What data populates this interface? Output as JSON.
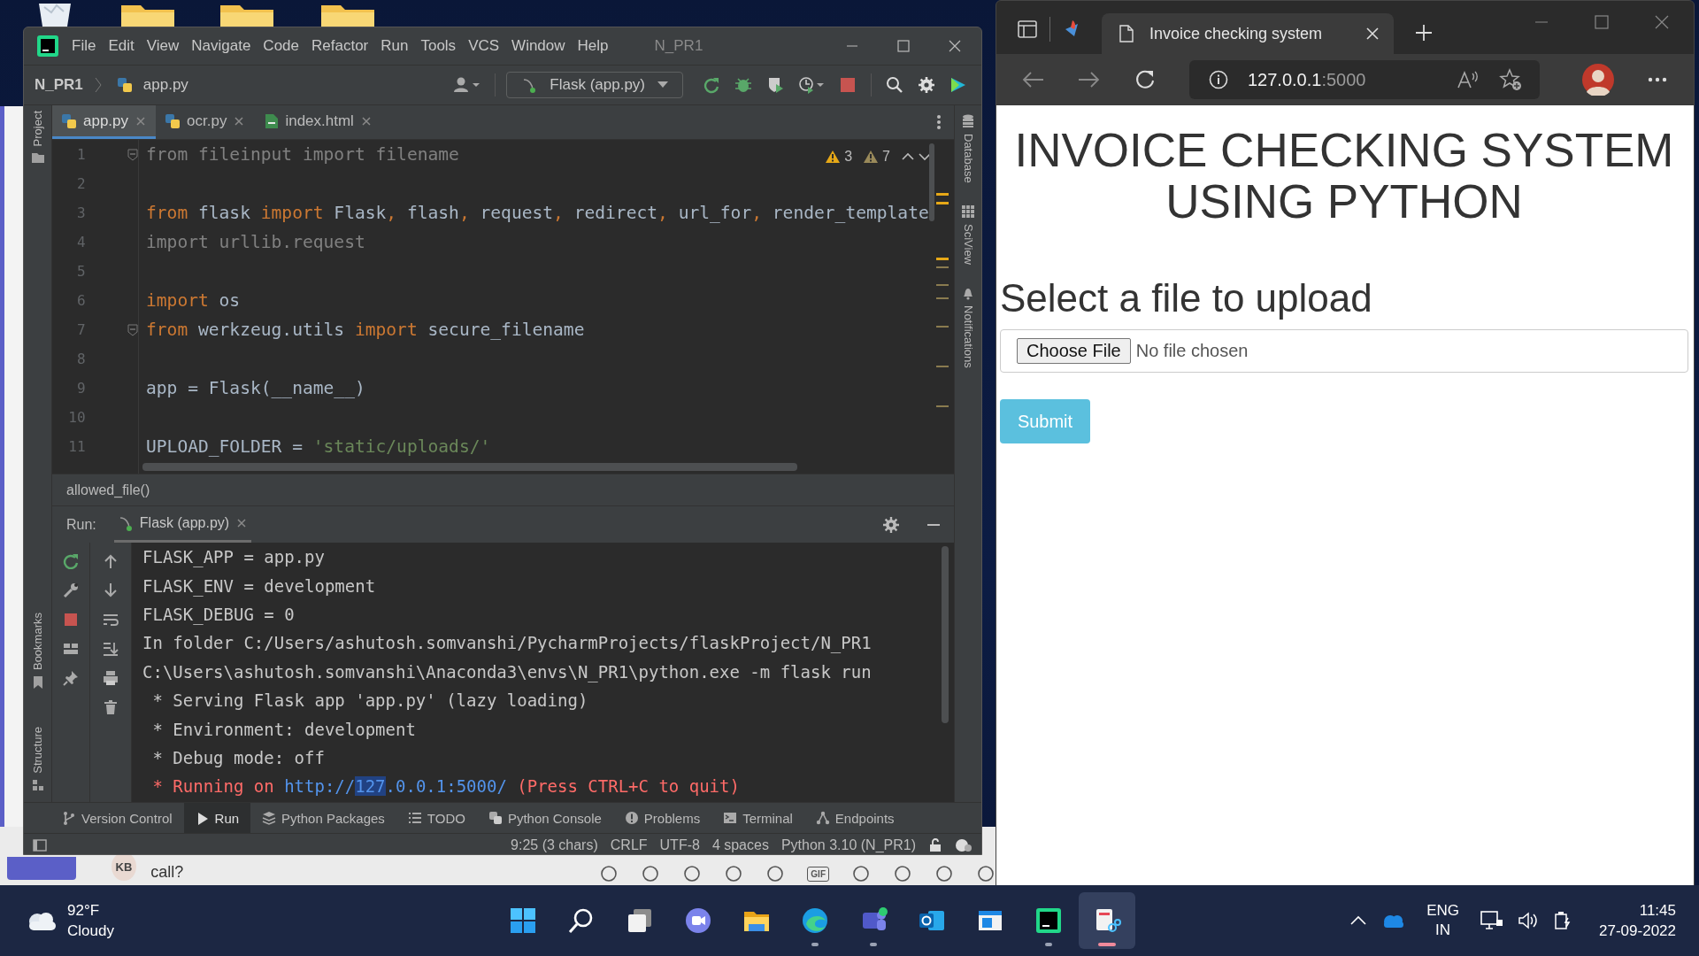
{
  "desktop": {
    "icons": [
      {
        "kind": "recycle-bin"
      },
      {
        "kind": "folder"
      },
      {
        "kind": "folder"
      },
      {
        "kind": "folder"
      }
    ]
  },
  "background_chat": {
    "avatar": "KB",
    "message": "call?",
    "gif_label": "GIF"
  },
  "ide": {
    "menu": [
      "File",
      "Edit",
      "View",
      "Navigate",
      "Code",
      "Refactor",
      "Run",
      "Tools",
      "VCS",
      "Window",
      "Help"
    ],
    "title": "N_PR1",
    "breadcrumb": [
      "N_PR1",
      "app.py"
    ],
    "run_config": "Flask (app.py)",
    "left_tools": [
      "Project",
      "Bookmarks",
      "Structure"
    ],
    "right_tools": [
      "Database",
      "SciView",
      "Notifications"
    ],
    "tabs": [
      {
        "label": "app.py",
        "kind": "python",
        "selected": true
      },
      {
        "label": "ocr.py",
        "kind": "python",
        "selected": false
      },
      {
        "label": "index.html",
        "kind": "html",
        "selected": false
      }
    ],
    "inspections": [
      {
        "kind": "warning",
        "count": "3"
      },
      {
        "kind": "weak-warning",
        "count": "7"
      }
    ],
    "code_lines": [
      {
        "number": "1",
        "fold": true,
        "tokens": [
          {
            "kind": "unused",
            "text": "from fileinput import filename"
          }
        ]
      },
      {
        "number": "2",
        "fold": false
      },
      {
        "number": "3",
        "fold": false,
        "tokens": [
          {
            "kind": "kw",
            "text": "from"
          },
          {
            "kind": "id",
            "text": " flask "
          },
          {
            "kind": "kw",
            "text": "import"
          },
          {
            "kind": "id",
            "text": " Flask"
          },
          {
            "kind": "kw",
            "text": ","
          },
          {
            "kind": "id",
            "text": " flash"
          },
          {
            "kind": "kw",
            "text": ","
          },
          {
            "kind": "id",
            "text": " request"
          },
          {
            "kind": "kw",
            "text": ","
          },
          {
            "kind": "id",
            "text": " redirect"
          },
          {
            "kind": "kw",
            "text": ","
          },
          {
            "kind": "id",
            "text": " url_for"
          },
          {
            "kind": "kw",
            "text": ","
          },
          {
            "kind": "id",
            "text": " render_template"
          }
        ]
      },
      {
        "number": "4",
        "fold": false,
        "tokens": [
          {
            "kind": "unused",
            "text": "import urllib.request"
          }
        ]
      },
      {
        "number": "5",
        "fold": false
      },
      {
        "number": "6",
        "fold": false,
        "tokens": [
          {
            "kind": "kw",
            "text": "import"
          },
          {
            "kind": "id",
            "text": " os"
          }
        ]
      },
      {
        "number": "7",
        "fold": true,
        "tokens": [
          {
            "kind": "kw",
            "text": "from"
          },
          {
            "kind": "id",
            "text": " werkzeug.utils "
          },
          {
            "kind": "kw",
            "text": "import"
          },
          {
            "kind": "id",
            "text": " secure_filename"
          }
        ]
      },
      {
        "number": "8",
        "fold": false
      },
      {
        "number": "9",
        "fold": false,
        "tokens": [
          {
            "kind": "id",
            "text": "app = Flask(__name__)"
          }
        ]
      },
      {
        "number": "10",
        "fold": false
      },
      {
        "number": "11",
        "fold": false,
        "tokens": [
          {
            "kind": "id",
            "text": "UPLOAD_FOLDER = "
          },
          {
            "kind": "str",
            "text": "'static/uploads/'"
          }
        ]
      }
    ],
    "scope": "allowed_file()",
    "run": {
      "label": "Run:",
      "tab": "Flask (app.py)",
      "lines": [
        {
          "segments": [
            {
              "kind": "normal",
              "text": "FLASK_APP = app.py"
            }
          ]
        },
        {
          "segments": [
            {
              "kind": "normal",
              "text": "FLASK_ENV = development"
            }
          ]
        },
        {
          "segments": [
            {
              "kind": "normal",
              "text": "FLASK_DEBUG = 0"
            }
          ]
        },
        {
          "segments": [
            {
              "kind": "normal",
              "text": "In folder C:/Users/ashutosh.somvanshi/PycharmProjects/flaskProject/N_PR1"
            }
          ]
        },
        {
          "segments": [
            {
              "kind": "normal",
              "text": "C:\\Users\\ashutosh.somvanshi\\Anaconda3\\envs\\N_PR1\\python.exe -m flask run"
            }
          ]
        },
        {
          "segments": [
            {
              "kind": "normal",
              "text": " * Serving Flask app 'app.py' (lazy loading)"
            }
          ]
        },
        {
          "segments": [
            {
              "kind": "normal",
              "text": " * Environment: development"
            }
          ]
        },
        {
          "segments": [
            {
              "kind": "normal",
              "text": " * Debug mode: off"
            }
          ]
        },
        {
          "segments": [
            {
              "kind": "error",
              "text": " * Running on "
            },
            {
              "kind": "link",
              "parts": [
                {
                  "text": "http://",
                  "selected": false
                },
                {
                  "text": "127",
                  "selected": true
                },
                {
                  "text": ".0.0.1:5000/",
                  "selected": false
                }
              ]
            },
            {
              "kind": "error",
              "text": " (Press CTRL+C to quit)"
            }
          ]
        }
      ]
    },
    "tool_windows": [
      {
        "label": "Version Control",
        "kind": "vcs",
        "selected": false
      },
      {
        "label": "Run",
        "kind": "run",
        "selected": true
      },
      {
        "label": "Python Packages",
        "kind": "packages",
        "selected": false
      },
      {
        "label": "TODO",
        "kind": "todo",
        "selected": false
      },
      {
        "label": "Python Console",
        "kind": "console",
        "selected": false
      },
      {
        "label": "Problems",
        "kind": "problems",
        "selected": false
      },
      {
        "label": "Terminal",
        "kind": "terminal",
        "selected": false
      },
      {
        "label": "Endpoints",
        "kind": "endpoints",
        "selected": false
      }
    ],
    "status": [
      "9:25 (3 chars)",
      "CRLF",
      "UTF-8",
      "4 spaces",
      "Python 3.10 (N_PR1)"
    ]
  },
  "browser": {
    "tab_title": "Invoice checking system",
    "url_host": "127.0.0.1",
    "url_port": ":5000",
    "page": {
      "heading": "INVOICE CHECKING SYSTEM USING PYTHON",
      "subheading": "Select a file to upload",
      "file_button": "Choose File",
      "file_status": "No file chosen",
      "submit": "Submit"
    }
  },
  "taskbar": {
    "weather": {
      "temperature": "92°F",
      "condition": "Cloudy"
    },
    "apps": [
      {
        "kind": "start",
        "running": false,
        "active": false
      },
      {
        "kind": "search",
        "running": false,
        "active": false
      },
      {
        "kind": "task-view",
        "running": false,
        "active": false
      },
      {
        "kind": "chat",
        "running": false,
        "active": false
      },
      {
        "kind": "files",
        "running": false,
        "active": false
      },
      {
        "kind": "browser",
        "running": true,
        "active": false
      },
      {
        "kind": "teams",
        "running": true,
        "active": false
      },
      {
        "kind": "mail",
        "running": false,
        "active": false
      },
      {
        "kind": "window",
        "running": false,
        "active": false
      },
      {
        "kind": "ide",
        "running": true,
        "active": false
      },
      {
        "kind": "snip",
        "running": true,
        "active": true
      }
    ],
    "language": "ENG",
    "region": "IN",
    "time": "11:45",
    "date": "27-09-2022"
  }
}
